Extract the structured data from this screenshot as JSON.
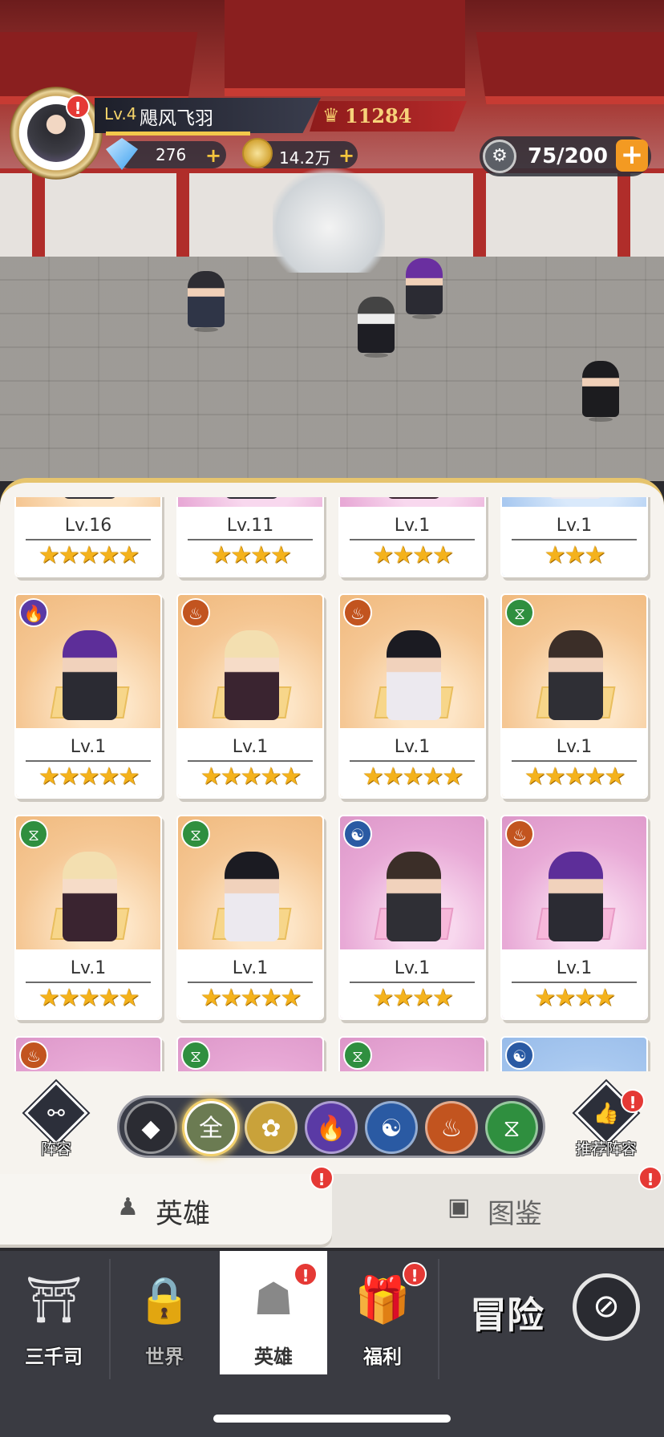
{
  "player": {
    "level": "Lv.4",
    "name": "飓风飞羽",
    "power_icon": "crown-shield-icon",
    "power": "11284",
    "gems": "276",
    "gold": "14.2万",
    "add_symbol": "+"
  },
  "stamina": {
    "value": "75/200",
    "add_symbol": "+"
  },
  "alert_symbol": "!",
  "hero_rows": [
    [
      {
        "level": "Lv.16",
        "stars": "★★★★★",
        "bg": "orange"
      },
      {
        "level": "Lv.11",
        "stars": "★★★★",
        "bg": "pink"
      },
      {
        "level": "Lv.1",
        "stars": "★★★★",
        "bg": "pink"
      },
      {
        "level": "Lv.1",
        "stars": "★★★",
        "bg": "blue"
      }
    ],
    [
      {
        "level": "Lv.1",
        "stars": "★★★★★",
        "bg": "orange",
        "faction": "fire"
      },
      {
        "level": "Lv.1",
        "stars": "★★★★★",
        "bg": "orange",
        "faction": "monk"
      },
      {
        "level": "Lv.1",
        "stars": "★★★★★",
        "bg": "orange",
        "faction": "monk"
      },
      {
        "level": "Lv.1",
        "stars": "★★★★★",
        "bg": "orange",
        "faction": "dna"
      }
    ],
    [
      {
        "level": "Lv.1",
        "stars": "★★★★★",
        "bg": "orange",
        "faction": "dna"
      },
      {
        "level": "Lv.1",
        "stars": "★★★★★",
        "bg": "orange",
        "faction": "dna"
      },
      {
        "level": "Lv.1",
        "stars": "★★★★",
        "bg": "pink",
        "faction": "swirl"
      },
      {
        "level": "Lv.1",
        "stars": "★★★★",
        "bg": "pink",
        "faction": "monk"
      }
    ],
    [
      {
        "bg": "pink",
        "faction": "monk"
      },
      {
        "bg": "pink",
        "faction": "dna"
      },
      {
        "bg": "pink",
        "faction": "dna"
      },
      {
        "bg": "blue",
        "faction": "swirl"
      }
    ]
  ],
  "faction_glyphs": {
    "fire": "🔥",
    "monk": "♨",
    "dna": "⧖",
    "swirl": "☯"
  },
  "filter_bar": {
    "lineup_label": "阵容",
    "recommend_label": "推荐阵容",
    "filters": [
      {
        "name": "filter-element-button",
        "glyph": "◆",
        "color": "#2b2c33"
      },
      {
        "name": "filter-all-button",
        "glyph": "全",
        "color": "#6b7b52",
        "active": true
      },
      {
        "name": "filter-lotus-button",
        "glyph": "✿",
        "color": "#c9a23a"
      },
      {
        "name": "filter-fire-button",
        "glyph": "🔥",
        "color": "#5a3aa5"
      },
      {
        "name": "filter-swirl-button",
        "glyph": "☯",
        "color": "#2a5aa3"
      },
      {
        "name": "filter-monk-button",
        "glyph": "♨",
        "color": "#c2541f"
      },
      {
        "name": "filter-dna-button",
        "glyph": "⧖",
        "color": "#2f8f3f"
      }
    ]
  },
  "tabs": {
    "heroes": "英雄",
    "codex": "图鉴"
  },
  "bottom_nav": {
    "items": [
      {
        "label": "三千司",
        "icon": "temple-icon"
      },
      {
        "label": "世界",
        "icon": "lock-globe-icon"
      },
      {
        "label": "英雄",
        "icon": "hero-silhouette-icon"
      },
      {
        "label": "福利",
        "icon": "gift-box-icon"
      }
    ],
    "adventure": "冒险"
  }
}
